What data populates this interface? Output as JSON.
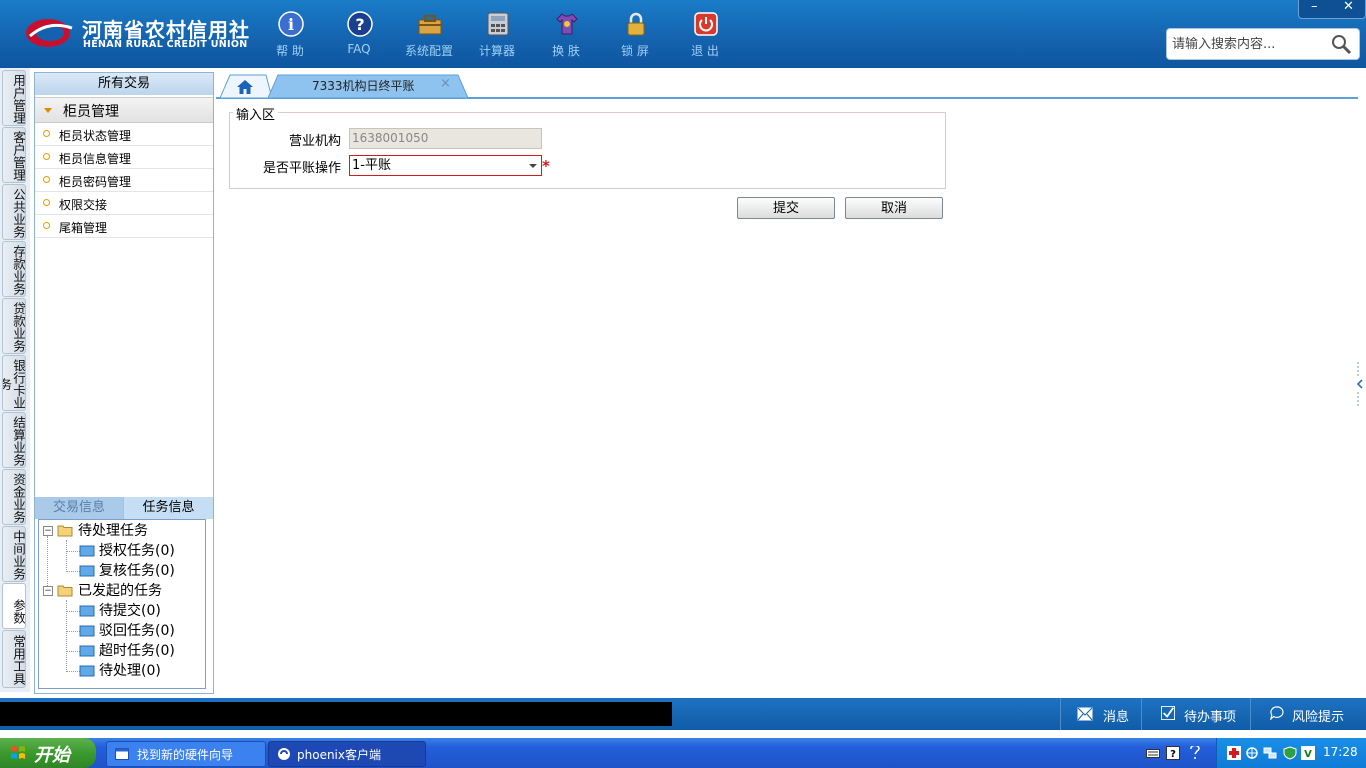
{
  "brand": {
    "name_cn": "河南省农村信用社",
    "name_en": "HENAN RURAL CREDIT UNION"
  },
  "toolbar": [
    {
      "label": "帮 助",
      "icon": "info-icon"
    },
    {
      "label": "FAQ",
      "icon": "faq-icon"
    },
    {
      "label": "系统配置",
      "icon": "toolbox-icon"
    },
    {
      "label": "计算器",
      "icon": "calculator-icon"
    },
    {
      "label": "换 肤",
      "icon": "shirt-icon"
    },
    {
      "label": "锁 屏",
      "icon": "lock-icon"
    },
    {
      "label": "退 出",
      "icon": "power-icon"
    }
  ],
  "window_controls": {
    "minimize": "–",
    "close": "✕"
  },
  "search": {
    "placeholder": "请输入搜索内容..."
  },
  "vertical_tabs": [
    "用户管理",
    "客户管理",
    "公共业务",
    "存款业务",
    "贷款业务",
    "银行卡业务",
    "结算业务",
    "资金业务",
    "中间业务",
    "参数",
    "常用工具"
  ],
  "left_panel": {
    "title": "所有交易",
    "category": "柜员管理",
    "items": [
      "柜员状态管理",
      "柜员信息管理",
      "柜员密码管理",
      "权限交接",
      "尾箱管理"
    ],
    "info_tabs": [
      "交易信息",
      "任务信息"
    ],
    "tree": {
      "pending": {
        "label": "待处理任务",
        "children": [
          "授权任务(0)",
          "复核任务(0)"
        ]
      },
      "initiated": {
        "label": "已发起的任务",
        "children": [
          "待提交(0)",
          "驳回任务(0)",
          "超时任务(0)",
          "待处理(0)"
        ]
      }
    }
  },
  "tabs": {
    "active": "7333机构日终平账",
    "close": "×"
  },
  "form": {
    "legend": "输入区",
    "org_label": "营业机构",
    "org_value": "1638001050",
    "balance_label": "是否平账操作",
    "balance_value": "1-平账",
    "required_mark": "*",
    "submit": "提交",
    "cancel": "取消"
  },
  "status_bar": {
    "message": "消息",
    "todo": "待办事项",
    "risk": "风险提示"
  },
  "taskbar": {
    "start": "开始",
    "tasks": [
      "找到新的硬件向导",
      "phoenix客户端"
    ],
    "clock": "17:28"
  },
  "colors": {
    "header": "#1462ad",
    "accent": "#5aa1dc",
    "required": "#d31b1b"
  }
}
